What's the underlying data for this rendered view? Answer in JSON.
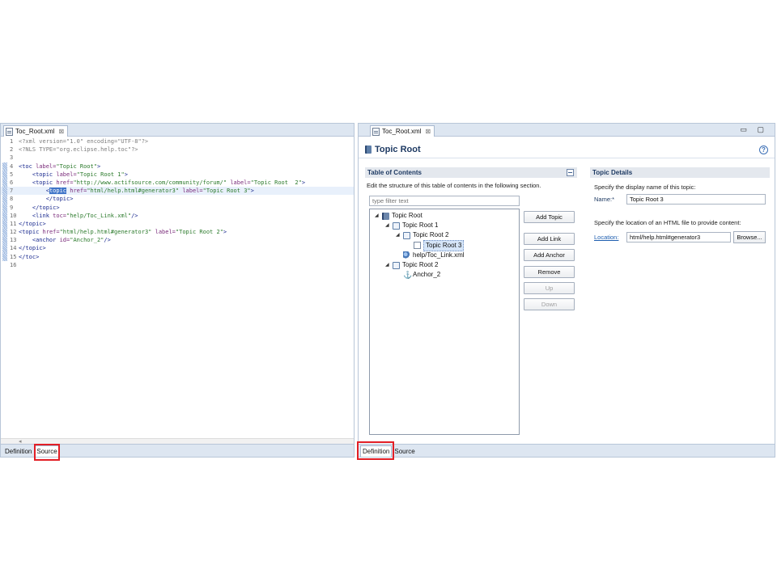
{
  "left_editor": {
    "tab_title": "Toc_Root.xml",
    "tab_close": "⊠",
    "lines": [
      {
        "n": "1",
        "mark": false,
        "hl": false,
        "parts": [
          {
            "c": "xml-pi",
            "t": "<?xml version=\"1.0\" encoding=\"UTF-8\"?>"
          }
        ]
      },
      {
        "n": "2",
        "mark": false,
        "hl": false,
        "parts": [
          {
            "c": "xml-pi",
            "t": "<?NLS TYPE=\"org.eclipse.help.toc\"?>"
          }
        ]
      },
      {
        "n": "3",
        "mark": false,
        "hl": false,
        "parts": []
      },
      {
        "n": "4",
        "mark": true,
        "hl": false,
        "parts": [
          {
            "c": "xml-tag",
            "t": "<toc "
          },
          {
            "c": "xml-attr",
            "t": "label="
          },
          {
            "c": "xml-str",
            "t": "\"Topic Root\""
          },
          {
            "c": "xml-tag",
            "t": ">"
          }
        ]
      },
      {
        "n": "5",
        "mark": true,
        "hl": false,
        "parts": [
          {
            "c": "",
            "t": "    "
          },
          {
            "c": "xml-tag",
            "t": "<topic "
          },
          {
            "c": "xml-attr",
            "t": "label="
          },
          {
            "c": "xml-str",
            "t": "\"Topic Root 1\""
          },
          {
            "c": "xml-tag",
            "t": ">"
          }
        ]
      },
      {
        "n": "6",
        "mark": true,
        "hl": false,
        "parts": [
          {
            "c": "",
            "t": "    "
          },
          {
            "c": "xml-tag",
            "t": "<topic "
          },
          {
            "c": "xml-attr",
            "t": "href="
          },
          {
            "c": "xml-str",
            "t": "\"http://www.actifsource.com/community/forum/\""
          },
          {
            "c": "",
            "t": " "
          },
          {
            "c": "xml-attr",
            "t": "label="
          },
          {
            "c": "xml-str",
            "t": "\"Topic Root  2\""
          },
          {
            "c": "xml-tag",
            "t": ">"
          }
        ]
      },
      {
        "n": "7",
        "mark": true,
        "hl": true,
        "parts": [
          {
            "c": "",
            "t": "        "
          },
          {
            "c": "xml-tag",
            "t": "<"
          },
          {
            "c": "sel",
            "t": "topic"
          },
          {
            "c": "xml-tag",
            "t": " "
          },
          {
            "c": "xml-attr",
            "t": "href="
          },
          {
            "c": "xml-str",
            "t": "\"html/help.html#generator3\""
          },
          {
            "c": "",
            "t": " "
          },
          {
            "c": "xml-attr",
            "t": "label="
          },
          {
            "c": "xml-str",
            "t": "\"Topic Root 3\""
          },
          {
            "c": "xml-tag",
            "t": ">"
          }
        ]
      },
      {
        "n": "8",
        "mark": true,
        "hl": false,
        "parts": [
          {
            "c": "",
            "t": "        "
          },
          {
            "c": "xml-tag",
            "t": "</topic>"
          }
        ]
      },
      {
        "n": "9",
        "mark": true,
        "hl": false,
        "parts": [
          {
            "c": "",
            "t": "    "
          },
          {
            "c": "xml-tag",
            "t": "</topic>"
          }
        ]
      },
      {
        "n": "10",
        "mark": true,
        "hl": false,
        "parts": [
          {
            "c": "",
            "t": "    "
          },
          {
            "c": "xml-tag",
            "t": "<link "
          },
          {
            "c": "xml-attr",
            "t": "toc="
          },
          {
            "c": "xml-str",
            "t": "\"help/Toc_Link.xml\""
          },
          {
            "c": "xml-tag",
            "t": "/>"
          }
        ]
      },
      {
        "n": "11",
        "mark": true,
        "hl": false,
        "parts": [
          {
            "c": "xml-tag",
            "t": "</topic>"
          }
        ]
      },
      {
        "n": "12",
        "mark": true,
        "hl": false,
        "parts": [
          {
            "c": "xml-tag",
            "t": "<topic "
          },
          {
            "c": "xml-attr",
            "t": "href="
          },
          {
            "c": "xml-str",
            "t": "\"html/help.html#generator3\""
          },
          {
            "c": "",
            "t": " "
          },
          {
            "c": "xml-attr",
            "t": "label="
          },
          {
            "c": "xml-str",
            "t": "\"Topic Root 2\""
          },
          {
            "c": "xml-tag",
            "t": ">"
          }
        ]
      },
      {
        "n": "13",
        "mark": true,
        "hl": false,
        "parts": [
          {
            "c": "",
            "t": "    "
          },
          {
            "c": "xml-tag",
            "t": "<anchor "
          },
          {
            "c": "xml-attr",
            "t": "id="
          },
          {
            "c": "xml-str",
            "t": "\"Anchor_2\""
          },
          {
            "c": "xml-tag",
            "t": "/>"
          }
        ]
      },
      {
        "n": "14",
        "mark": true,
        "hl": false,
        "parts": [
          {
            "c": "xml-tag",
            "t": "</topic>"
          }
        ]
      },
      {
        "n": "15",
        "mark": true,
        "hl": false,
        "parts": [
          {
            "c": "xml-tag",
            "t": "</toc>"
          }
        ]
      },
      {
        "n": "16",
        "mark": false,
        "hl": false,
        "parts": []
      }
    ],
    "scroll_arrow": "◂",
    "bottom_tabs": [
      {
        "label": "Definition",
        "active": false
      },
      {
        "label": "Source",
        "active": true
      }
    ]
  },
  "right_editor": {
    "tab_title": "Toc_Root.xml",
    "tab_close": "⊠",
    "window_controls": "▭ ▢",
    "page_title": "Topic Root",
    "help_glyph": "?",
    "toc_section": {
      "title": "Table of Contents",
      "description": "Edit the structure of this table of contents in the following section.",
      "filter_placeholder": "type filter text",
      "tree": [
        {
          "label": "Topic Root",
          "icon": "book",
          "depth": 0,
          "twisty": "◢",
          "selected": false
        },
        {
          "label": "Topic Root 1",
          "icon": "open",
          "depth": 1,
          "twisty": "◢",
          "selected": false
        },
        {
          "label": "Topic Root 2",
          "icon": "open",
          "depth": 2,
          "twisty": "◢",
          "selected": false
        },
        {
          "label": "Topic Root 3",
          "icon": "page",
          "depth": 3,
          "twisty": "",
          "selected": true
        },
        {
          "label": "help/Toc_Link.xml",
          "icon": "link",
          "depth": 2,
          "twisty": "",
          "selected": false
        },
        {
          "label": "Topic Root 2",
          "icon": "open",
          "depth": 1,
          "twisty": "◢",
          "selected": false
        },
        {
          "label": "Anchor_2",
          "icon": "anchor",
          "depth": 2,
          "twisty": "",
          "selected": false
        }
      ],
      "buttons": [
        {
          "label": "Add Topic",
          "enabled": true
        },
        {
          "label": "Add Link",
          "enabled": true
        },
        {
          "label": "Add Anchor",
          "enabled": true
        },
        {
          "label": "Remove",
          "enabled": true
        },
        {
          "label": "Up",
          "enabled": false
        },
        {
          "label": "Down",
          "enabled": false
        }
      ]
    },
    "details_section": {
      "title": "Topic Details",
      "name_desc": "Specify the display name of this topic:",
      "name_label": "Name:*",
      "name_value": "Topic Root 3",
      "location_desc": "Specify the location of an HTML file to provide content:",
      "location_label": "Location:",
      "location_value": "html/help.html#generator3",
      "browse_label": "Browse..."
    },
    "bottom_tabs": [
      {
        "label": "Definition",
        "active": true
      },
      {
        "label": "Source",
        "active": false
      }
    ]
  },
  "colors": {
    "highlight_box": "#e21f26",
    "accent": "#1e3a63",
    "tab_bar": "#dde6f1"
  }
}
